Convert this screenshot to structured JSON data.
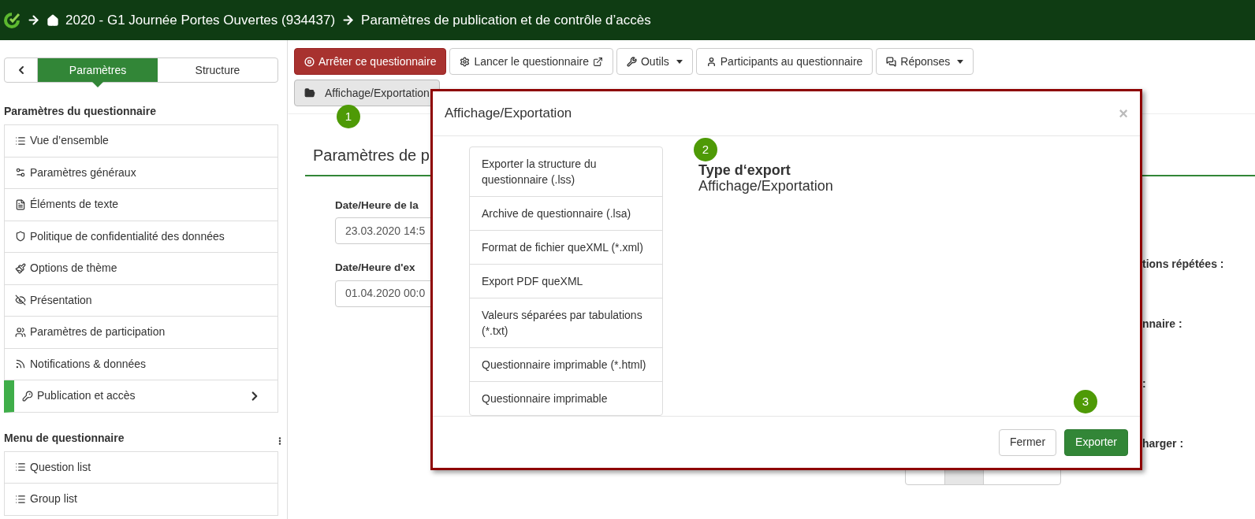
{
  "header": {
    "crumbs": [
      {
        "text": "2020 - G1 Journée Portes Ouvertes (934437)",
        "kind": "home"
      },
      {
        "text": "Paramètres de publication et de contrôle d’accès",
        "kind": "page"
      }
    ]
  },
  "sidebar": {
    "tabs": [
      {
        "label": "Paramètres",
        "selected": true
      },
      {
        "label": "Structure",
        "selected": false
      }
    ],
    "sections": [
      {
        "title": "Paramètres du questionnaire",
        "items": [
          {
            "label": "Vue d’ensemble",
            "selected": false
          },
          {
            "label": "Paramètres généraux",
            "selected": false
          },
          {
            "label": "Éléments de texte",
            "selected": false
          },
          {
            "label": "Politique de confidentialité des données",
            "selected": false
          },
          {
            "label": "Options de thème",
            "selected": false
          },
          {
            "label": "Présentation",
            "selected": false
          },
          {
            "label": "Paramètres de participation",
            "selected": false
          },
          {
            "label": "Notifications & données",
            "selected": false
          },
          {
            "label": "Publication et accès",
            "selected": true
          }
        ]
      },
      {
        "title": "Menu de questionnaire",
        "items": [
          {
            "label": "Question list",
            "selected": false
          },
          {
            "label": "Group list",
            "selected": false
          }
        ]
      }
    ]
  },
  "toolbar": {
    "buttons": [
      {
        "label": "Arrêter ce questionnaire",
        "kind": "danger",
        "caret": false
      },
      {
        "label": "Lancer le questionnaire",
        "kind": "default",
        "caret": false
      },
      {
        "label": "Outils",
        "kind": "default",
        "caret": true
      },
      {
        "label": "Participants au questionnaire",
        "kind": "default",
        "caret": false
      },
      {
        "label": "Réponses",
        "kind": "default",
        "caret": true
      }
    ],
    "view_button": {
      "label": "Affichage/Exportation",
      "selected": true
    },
    "step_marker": "1"
  },
  "content": {
    "heading": "Paramètres de p",
    "fields": [
      {
        "label": "Date/Heure de la",
        "value": "23.03.2020 14:5"
      },
      {
        "label": "Date/Heure d'ex",
        "value": "01.04.2020 00:0"
      }
    ],
    "side_labels": [
      "tions répétées :",
      "nnaire :",
      ":",
      "harger :"
    ],
    "segments": [
      {
        "selected": false
      },
      {
        "selected": true
      },
      {
        "selected": false
      }
    ]
  },
  "modal": {
    "title": "Affichage/Exportation",
    "close": "×",
    "options": [
      "Exporter la structure du questionnaire (.lss)",
      "Archive de questionnaire (.lsa)",
      "Format de fichier queXML (*.xml)",
      "Export PDF queXML",
      "Valeurs séparées par tabulations (*.txt)",
      "Questionnaire imprimable (*.html)",
      "Questionnaire imprimable"
    ],
    "step_marker": "2",
    "type_label": "Type d‘export",
    "type_value": "Affichage/Exportation",
    "footer_step_marker": "3",
    "buttons": [
      {
        "label": "Fermer",
        "kind": "default"
      },
      {
        "label": "Exporter",
        "kind": "primary"
      }
    ]
  }
}
